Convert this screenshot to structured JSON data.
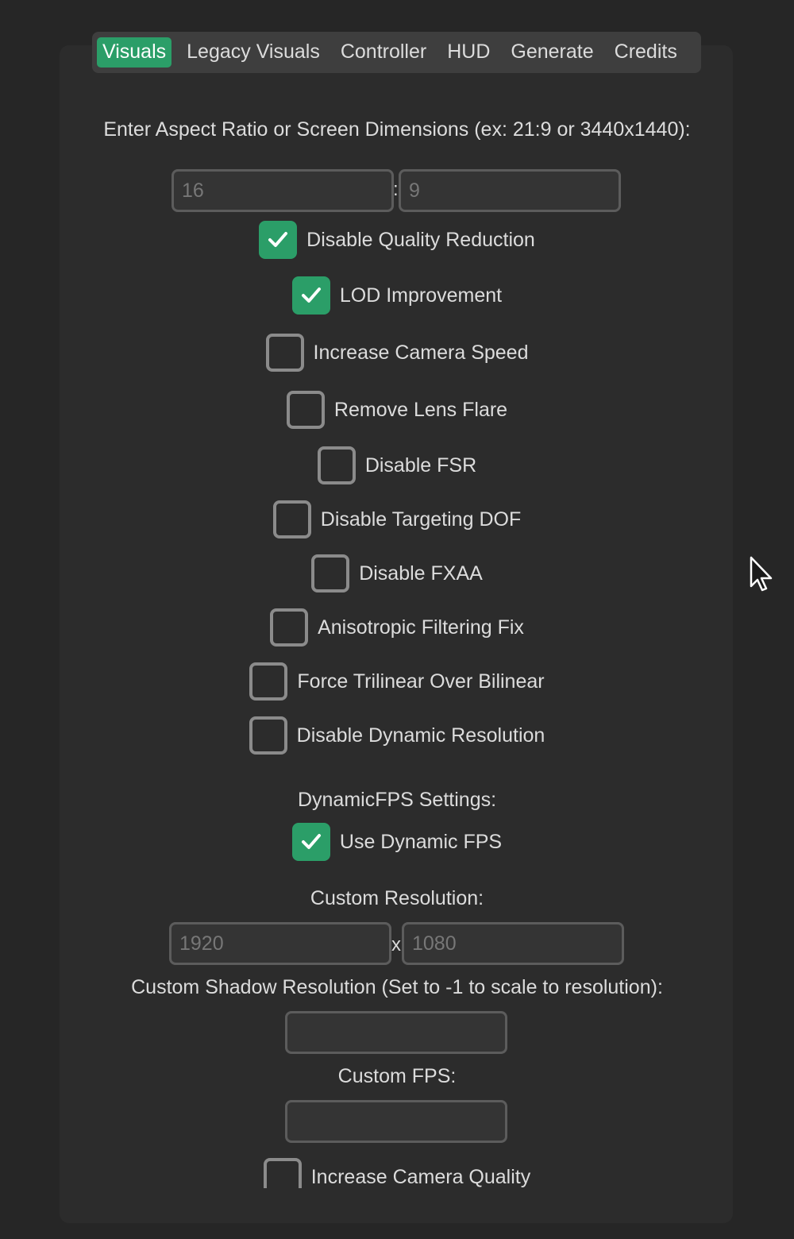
{
  "tabs": [
    {
      "label": "Visuals",
      "active": true
    },
    {
      "label": "Legacy Visuals",
      "active": false
    },
    {
      "label": "Controller",
      "active": false
    },
    {
      "label": "HUD",
      "active": false
    },
    {
      "label": "Generate",
      "active": false
    },
    {
      "label": "Credits",
      "active": false
    }
  ],
  "aspect": {
    "prompt": "Enter Aspect Ratio or Screen Dimensions (ex: 21:9 or 3440x1440):",
    "width_placeholder": "16",
    "separator": ":",
    "height_placeholder": "9"
  },
  "options": [
    {
      "label": "Disable Quality Reduction",
      "checked": true
    },
    {
      "label": "LOD Improvement",
      "checked": true
    },
    {
      "label": "Increase Camera Speed",
      "checked": false
    },
    {
      "label": "Remove Lens Flare",
      "checked": false
    },
    {
      "label": "Disable FSR",
      "checked": false
    },
    {
      "label": "Disable Targeting DOF",
      "checked": false
    },
    {
      "label": "Disable FXAA",
      "checked": false
    },
    {
      "label": "Anisotropic Filtering Fix",
      "checked": false
    },
    {
      "label": "Force Trilinear Over Bilinear",
      "checked": false
    },
    {
      "label": "Disable Dynamic Resolution",
      "checked": false
    }
  ],
  "dynamic_fps": {
    "heading": "DynamicFPS Settings:",
    "use_label": "Use Dynamic FPS",
    "use_checked": true
  },
  "custom_resolution": {
    "heading": "Custom Resolution:",
    "width_placeholder": "1920",
    "separator": "x",
    "height_placeholder": "1080"
  },
  "shadow": {
    "heading": "Custom Shadow Resolution (Set to -1 to scale to resolution):",
    "value": ""
  },
  "custom_fps": {
    "heading": "Custom FPS:",
    "value": ""
  },
  "camera_quality": {
    "label": "Increase Camera Quality",
    "checked": false
  },
  "colors": {
    "background": "#262626",
    "panel": "#2c2c2c",
    "tabbar": "#3e3e3e",
    "accent": "#2b9e68",
    "checkbox_border": "#8b8b8b",
    "input_border": "#5c5c5c"
  },
  "icons": {
    "check": "checkmark-icon",
    "cursor": "mouse-pointer-icon"
  }
}
